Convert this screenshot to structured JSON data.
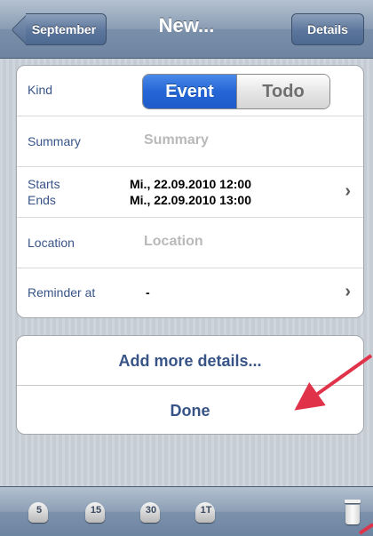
{
  "navbar": {
    "back_label": "September",
    "title": "New...",
    "details_label": "Details"
  },
  "form": {
    "kind_label": "Kind",
    "kind_options": [
      "Event",
      "Todo"
    ],
    "kind_selected": "Event",
    "summary_label": "Summary",
    "summary_placeholder": "Summary",
    "starts_label": "Starts",
    "ends_label": "Ends",
    "starts_value": "Mi., 22.09.2010 12:00",
    "ends_value": "Mi., 22.09.2010 13:00",
    "location_label": "Location",
    "location_placeholder": "Location",
    "reminder_label": "Reminder at",
    "reminder_value": "-"
  },
  "actions": {
    "add_details_label": "Add more details...",
    "done_label": "Done"
  },
  "toolbar": {
    "reminder_buttons": [
      "5",
      "15",
      "30",
      "1T"
    ]
  },
  "colors": {
    "accent_blue": "#2465d6",
    "label_blue": "#385487",
    "annotation_red": "#e0334a"
  },
  "icons": [
    "chevron-right-icon",
    "bell-icon",
    "trash-icon",
    "back-arrow-icon"
  ]
}
